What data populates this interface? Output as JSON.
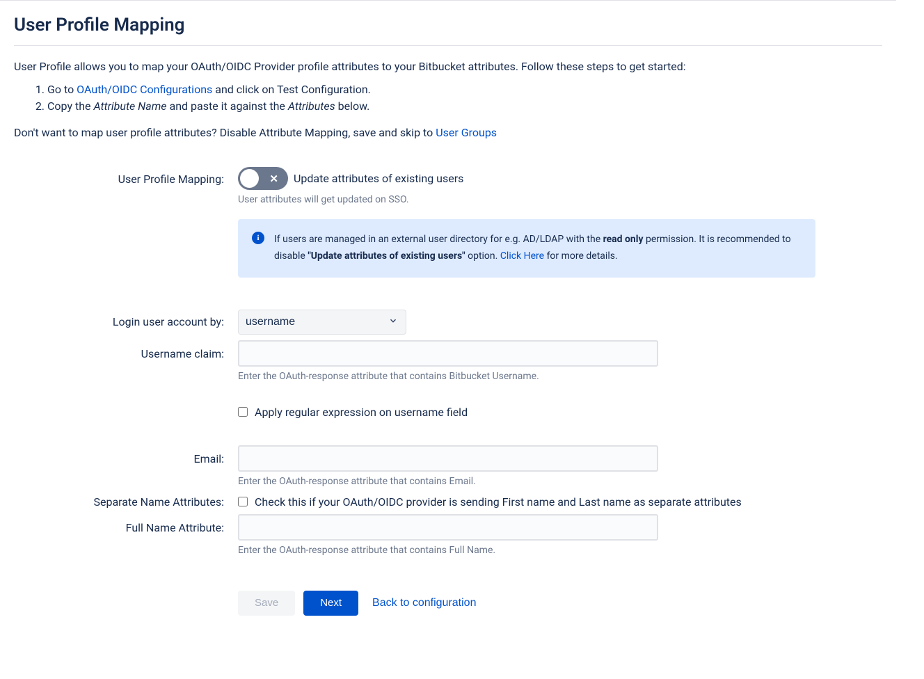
{
  "page": {
    "title": "User Profile Mapping",
    "intro": "User Profile allows you to map your OAuth/OIDC Provider profile attributes to your Bitbucket attributes. Follow these steps to get started:",
    "step1_pre": "Go to ",
    "step1_link": "OAuth/OIDC Configurations",
    "step1_post": " and click on Test Configuration.",
    "step2_pre": "Copy the ",
    "step2_em1": "Attribute Name",
    "step2_mid": " and paste it against the ",
    "step2_em2": "Attributes",
    "step2_post": " below.",
    "disable_pre": "Don't want to map user profile attributes? Disable Attribute Mapping, save and skip to ",
    "disable_link": "User Groups"
  },
  "form": {
    "mapping_label": "User Profile Mapping:",
    "toggle_text": "Update attributes of existing users",
    "toggle_hint": "User attributes will get updated on SSO.",
    "info_pre": "If users are managed in an external user directory for e.g. AD/LDAP with the ",
    "info_bold1": "read only",
    "info_mid": " permission. It is recommended to disable ",
    "info_bold2": "\"Update attributes of existing users\"",
    "info_post1": " option. ",
    "info_link": "Click Here",
    "info_post2": " for more details.",
    "login_by_label": "Login user account by:",
    "login_by_value": "username",
    "username_label": "Username claim:",
    "username_value": "",
    "username_hint": "Enter the OAuth-response attribute that contains Bitbucket Username.",
    "regex_label": "Apply regular expression on username field",
    "email_label": "Email:",
    "email_value": "",
    "email_hint": "Enter the OAuth-response attribute that contains Email.",
    "sep_name_label": "Separate Name Attributes:",
    "sep_name_check": "Check this if your OAuth/OIDC provider is sending First name and Last name as separate attributes",
    "fullname_label": "Full Name Attribute:",
    "fullname_value": "",
    "fullname_hint": "Enter the OAuth-response attribute that contains Full Name."
  },
  "buttons": {
    "save": "Save",
    "next": "Next",
    "back": "Back to configuration"
  }
}
